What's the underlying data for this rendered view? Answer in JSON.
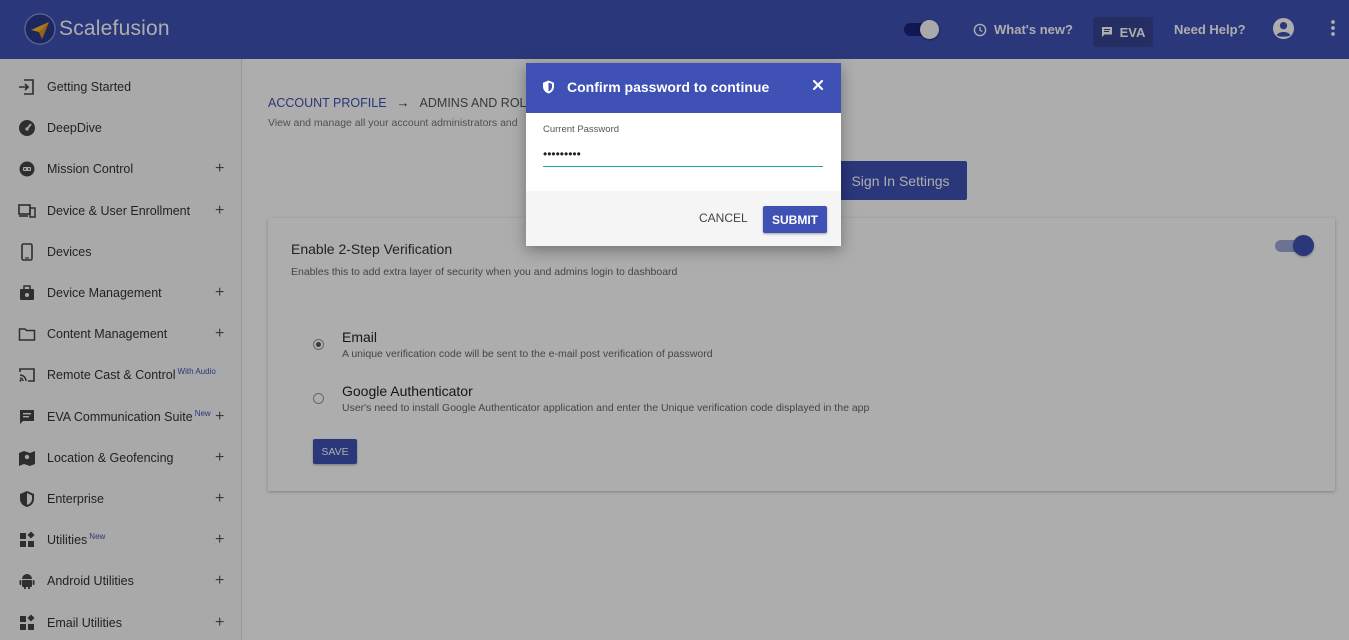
{
  "header": {
    "brand": "Scalefusion",
    "whats_new": "What's new?",
    "eva": "EVA",
    "need_help": "Need Help?"
  },
  "sidebar": {
    "items": [
      {
        "label": "Getting Started",
        "icon": "enter-icon",
        "expandable": false
      },
      {
        "label": "DeepDive",
        "icon": "gauge-icon",
        "expandable": false
      },
      {
        "label": "Mission Control",
        "icon": "control-icon",
        "expandable": true
      },
      {
        "label": "Device & User Enrollment",
        "icon": "devices-icon",
        "expandable": true
      },
      {
        "label": "Devices",
        "icon": "phone-icon",
        "expandable": false
      },
      {
        "label": "Device Management",
        "icon": "briefcase-icon",
        "expandable": true
      },
      {
        "label": "Content Management",
        "icon": "folder-icon",
        "expandable": true
      },
      {
        "label": "Remote Cast & Control",
        "badge": "With Audio",
        "icon": "cast-icon",
        "expandable": false
      },
      {
        "label": "EVA Communication Suite",
        "badge": "New",
        "icon": "chat-icon",
        "expandable": true
      },
      {
        "label": "Location & Geofencing",
        "icon": "map-icon",
        "expandable": true
      },
      {
        "label": "Enterprise",
        "icon": "shield-icon",
        "expandable": true
      },
      {
        "label": "Utilities",
        "badge": "New",
        "icon": "widgets-icon",
        "expandable": true
      },
      {
        "label": "Android Utilities",
        "icon": "android-icon",
        "expandable": true
      },
      {
        "label": "Email Utilities",
        "icon": "widgets-icon",
        "expandable": true
      }
    ],
    "plus": "+"
  },
  "main": {
    "breadcrumb_root": "ACCOUNT PROFILE",
    "breadcrumb_arrow": "→",
    "breadcrumb_current": "ADMINS AND ROLES",
    "description": "View and manage all your account administrators and",
    "signin_settings": "Sign In Settings",
    "card": {
      "title": "Enable 2-Step Verification",
      "description": "Enables this to add extra layer of security when you and admins login to dashboard",
      "enabled": true,
      "options": [
        {
          "title": "Email",
          "description": "A unique verification code will be sent to the e-mail post verification of password",
          "selected": true
        },
        {
          "title": "Google Authenticator",
          "description": "User's need to install Google Authenticator application and enter the Unique verification code displayed in the app",
          "selected": false
        }
      ],
      "save": "SAVE"
    }
  },
  "dialog": {
    "title": "Confirm password to continue",
    "field_label": "Current Password",
    "field_value": "secret123",
    "cancel": "CANCEL",
    "submit": "SUBMIT"
  },
  "colors": {
    "primary": "#3f51b5",
    "accent_underline": "#26a69a",
    "overlay": "rgba(0,0,0,0.32)"
  }
}
